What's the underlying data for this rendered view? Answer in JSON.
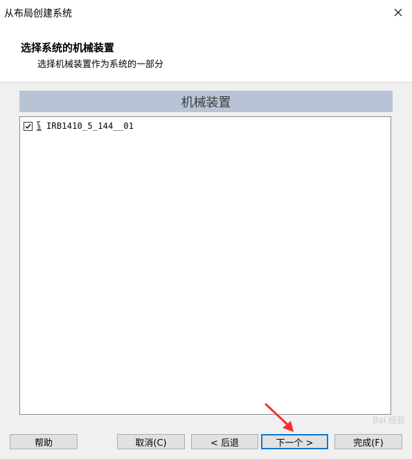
{
  "window": {
    "title": "从布局创建系统"
  },
  "header": {
    "title": "选择系统的机械装置",
    "subtitle": "选择机械装置作为系统的一部分"
  },
  "section": {
    "title": "机械装置"
  },
  "mechanisms": [
    {
      "label": "IRB1410_5_144__01",
      "checked": true,
      "icon": "robot-icon"
    }
  ],
  "buttons": {
    "help": "帮助",
    "cancel": "取消(C)",
    "back": "< 后退",
    "next": "下一个 >",
    "finish": "完成(F)"
  },
  "watermark": {
    "text": "Bai 经验"
  },
  "colors": {
    "section_header": "#b8c4d6",
    "primary_border": "#0078d7",
    "annotation_arrow": "#ff2a2a"
  }
}
